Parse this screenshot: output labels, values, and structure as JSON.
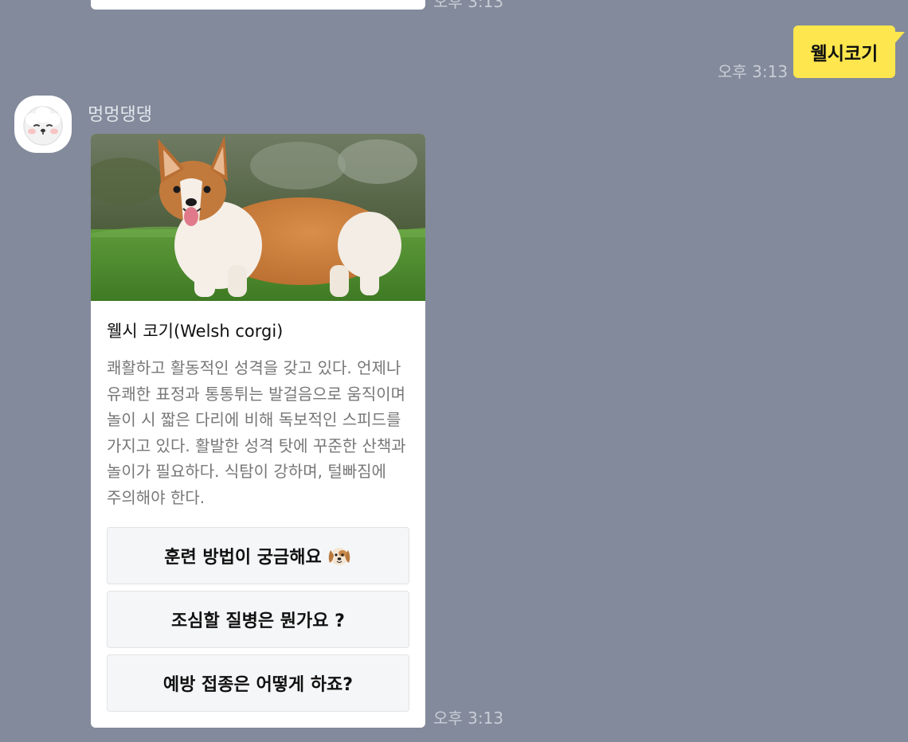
{
  "previous_message": {
    "time": "오후 3:13"
  },
  "sent_message": {
    "text": "웰시코기",
    "time": "오후 3:13",
    "bubble_color": "#fee64e"
  },
  "bot": {
    "name": "멍멍댕댕",
    "avatar_icon": "white-dog-face-icon"
  },
  "card": {
    "image": "welsh-corgi-photo",
    "title": "웰시 코기(Welsh corgi)",
    "description": "쾌활하고 활동적인 성격을 갖고 있다. 언제나 유쾌한 표정과 통통튀는 발걸음으로 움직이며 놀이 시 짧은 다리에 비해 독보적인 스피드를 가지고 있다. 활발한 성격 탓에 꾸준한 산책과 놀이가 필요하다. 식탐이 강하며, 털빠짐에 주의해야 한다.",
    "quick_replies": [
      {
        "label": "훈련 방법이 궁금해요",
        "icon": "dog-face-emoji"
      },
      {
        "label": "조심할 질병은 뭔가요 ?"
      },
      {
        "label": "예방 접종은 어떻게 하죠?"
      }
    ],
    "time": "오후 3:13"
  },
  "colors": {
    "background": "#828a9b",
    "card": "#ffffff",
    "button": "#f5f6f7"
  }
}
